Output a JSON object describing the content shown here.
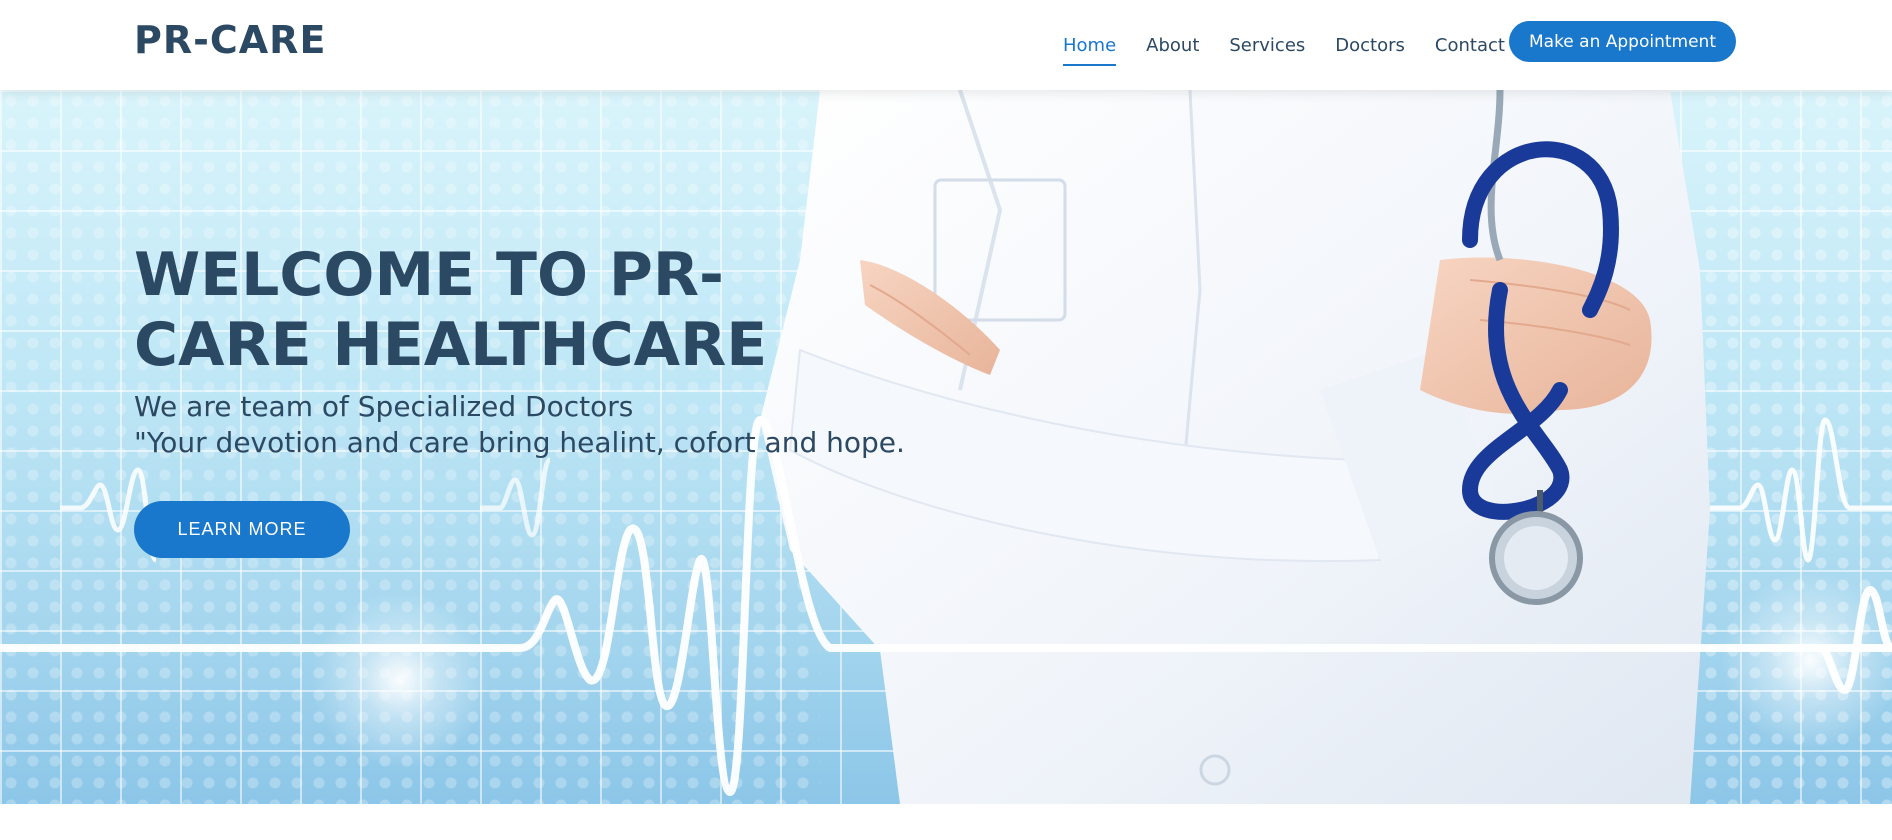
{
  "header": {
    "logo": "PR-CARE",
    "nav": [
      {
        "label": "Home",
        "active": true
      },
      {
        "label": "About",
        "active": false
      },
      {
        "label": "Services",
        "active": false
      },
      {
        "label": "Doctors",
        "active": false
      },
      {
        "label": "Contact",
        "active": false
      }
    ],
    "cta_label": "Make an Appointment"
  },
  "hero": {
    "title": "WELCOME TO PR-CARE HEALTHCARE",
    "line1": "We are team of Specialized Doctors",
    "line2": "\"Your devotion and care bring healint, cofort and hope.",
    "button_label": "LEARN MORE"
  },
  "colors": {
    "accent": "#1977cc",
    "heading": "#2c4964"
  }
}
